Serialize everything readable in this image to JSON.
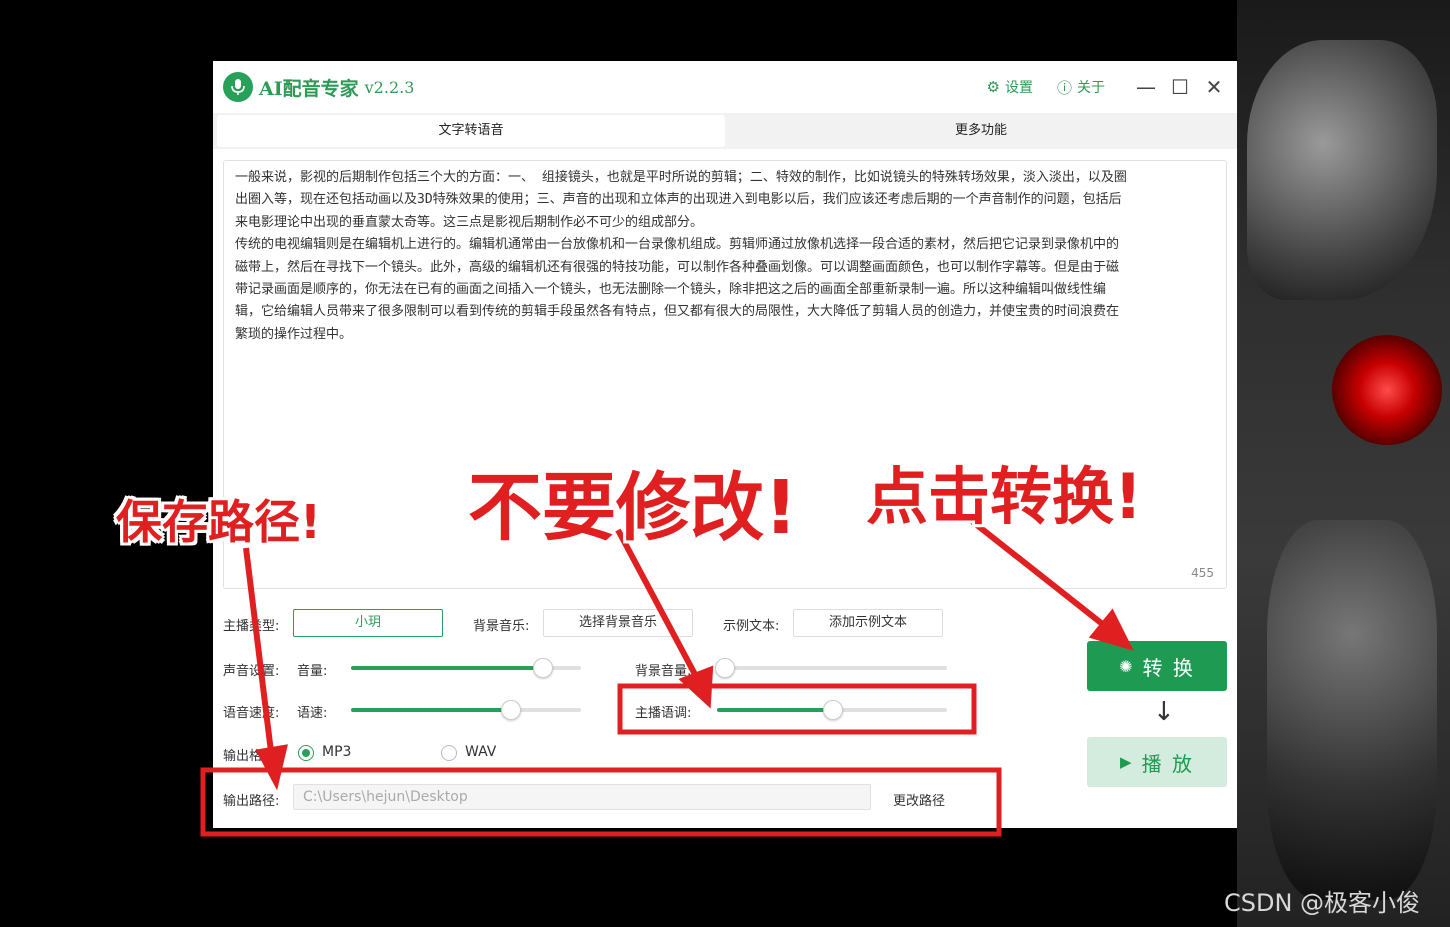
{
  "app": {
    "name": "AI配音专家",
    "version": "v2.2.3",
    "settings_label": "设置",
    "about_label": "关于",
    "minimize": "—",
    "maximize": "☐",
    "close": "✕"
  },
  "tabs": [
    {
      "label": "文字转语音",
      "active": true
    },
    {
      "label": "更多功能",
      "active": false
    }
  ],
  "editor": {
    "text": "一般来说，影视的后期制作包括三个大的方面：一、 组接镜头，也就是平时所说的剪辑；二、特效的制作，比如说镜头的特殊转场效果，淡入淡出，以及圈\n出圈入等，现在还包括动画以及3D特殊效果的使用；三、声音的出现和立体声的出现进入到电影以后，我们应该还考虑后期的一个声音制作的问题，包括后\n来电影理论中出现的垂直蒙太奇等。这三点是影视后期制作必不可少的组成部分。\n传统的电视编辑则是在编辑机上进行的。编辑机通常由一台放像机和一台录像机组成。剪辑师通过放像机选择一段合适的素材，然后把它记录到录像机中的\n磁带上，然后在寻找下一个镜头。此外，高级的编辑机还有很强的特技功能，可以制作各种叠画划像。可以调整画面颜色，也可以制作字幕等。但是由于磁\n带记录画面是顺序的，你无法在已有的画面之间插入一个镜头，也无法删除一个镜头，除非把这之后的画面全部重新录制一遍。所以这种编辑叫做线性编\n辑，它给编辑人员带来了很多限制可以看到传统的剪辑手段虽然各有特点，但又都有很大的局限性，大大降低了剪辑人员的创造力，并使宝贵的时间浪费在\n繁琐的操作过程中。",
    "char_count": "455"
  },
  "controls": {
    "anchor_type_label": "主播类型:",
    "anchor_value": "小玥",
    "bgm_label": "背景音乐:",
    "bgm_button": "选择背景音乐",
    "sample_label": "示例文本:",
    "sample_button": "添加示例文本",
    "sound_setting_label": "声音设置:",
    "volume_label": "音量:",
    "volume_level": 0.83,
    "bg_volume_label": "背景音量:",
    "bg_volume_level": 0.03,
    "speed_setting_label": "语音速度:",
    "speed_label": "语速:",
    "speed_level": 0.69,
    "tone_label": "主播语调:",
    "tone_level": 0.5,
    "format_label": "输出格式:",
    "format_mp3": "MP3",
    "format_wav": "WAV",
    "path_label": "输出路径:",
    "path_value": "C:\\Users\\hejun\\Desktop",
    "change_path": "更改路径",
    "convert_label": "转 换",
    "play_label": "播 放"
  },
  "annotations": {
    "save_path": "保存路径!",
    "do_not_modify": "不要修改!",
    "click_convert": "点击转换!"
  },
  "watermark": "CSDN @极客小俊",
  "colors": {
    "brand": "#27a05a",
    "annotation": "#e02020"
  }
}
